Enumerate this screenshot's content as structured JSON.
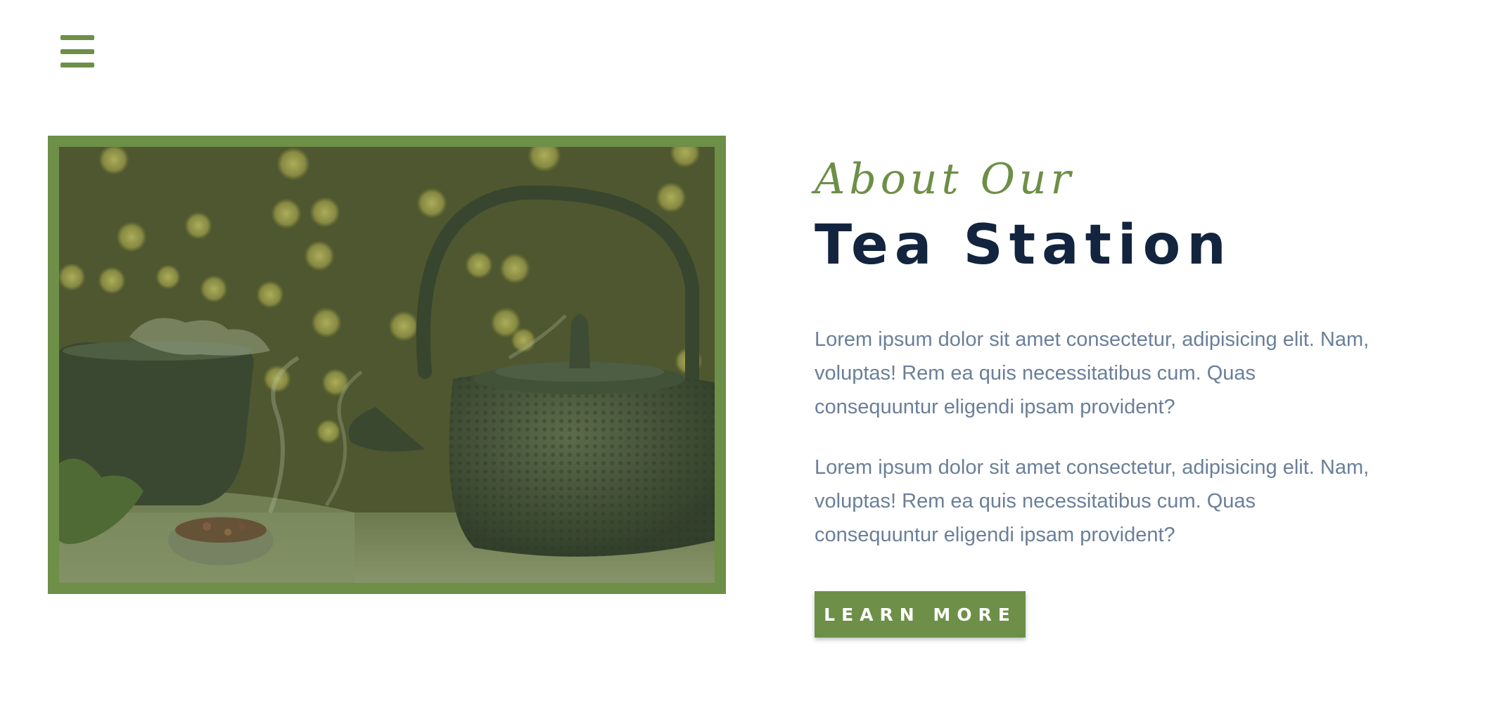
{
  "colors": {
    "accent": "#6d8f47",
    "heading": "#13243f",
    "body_text": "#6a7f99",
    "background": "#ffffff"
  },
  "nav": {
    "menu_icon": "hamburger-menu-icon"
  },
  "hero_image": {
    "subject": "teapot-photo"
  },
  "about": {
    "kicker": "About Our",
    "title": "Tea Station",
    "paragraphs": [
      "Lorem ipsum dolor sit amet consectetur, adipisicing elit. Nam, voluptas! Rem ea quis necessitatibus cum. Quas consequuntur eligendi ipsam provident?",
      "Lorem ipsum dolor sit amet consectetur, adipisicing elit. Nam, voluptas! Rem ea quis necessitatibus cum. Quas consequuntur eligendi ipsam provident?"
    ],
    "cta_label": "LEARN MORE"
  }
}
